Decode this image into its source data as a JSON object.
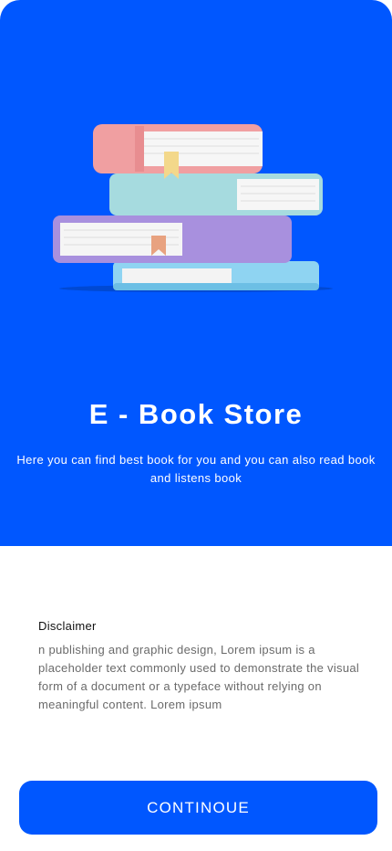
{
  "hero": {
    "title": "E - Book Store",
    "subtitle": "Here you can find best book for you and you can also read book and listens book",
    "illustration_icon": "book-stack-icon",
    "background_color": "#0057ff"
  },
  "disclaimer": {
    "title": "Disclaimer",
    "body": "n publishing and graphic design, Lorem ipsum is a placeholder text commonly used to demonstrate the visual form of a document or a typeface without relying on meaningful content. Lorem ipsum"
  },
  "actions": {
    "continue_label": "CONTINOUE",
    "button_color": "#0057ff"
  }
}
